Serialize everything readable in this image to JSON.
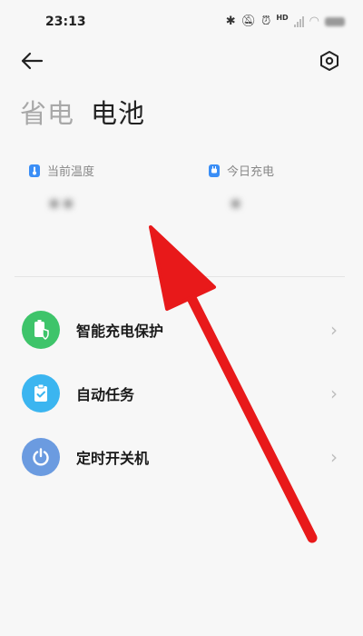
{
  "status_bar": {
    "time": "23:13",
    "hd_label": "HD",
    "icons": [
      "bluetooth-icon",
      "mute-icon",
      "alarm-icon",
      "signal-icon",
      "wifi-icon",
      "battery-icon"
    ]
  },
  "toolbar": {
    "back_icon": "arrow-left-icon",
    "settings_icon": "hex-gear-icon"
  },
  "tabs": [
    {
      "label": "省电",
      "active": false
    },
    {
      "label": "电池",
      "active": true
    }
  ],
  "stats": [
    {
      "label": "当前温度",
      "value": "••",
      "icon": "thermometer-icon",
      "icon_color": "#3a8ef6"
    },
    {
      "label": "今日充电",
      "value": "•",
      "icon": "plug-icon",
      "icon_color": "#3a8ef6"
    }
  ],
  "menu": [
    {
      "label": "智能充电保护",
      "icon": "battery-shield-icon",
      "color": "#3ec46a"
    },
    {
      "label": "自动任务",
      "icon": "clipboard-check-icon",
      "color": "#3bb5f0"
    },
    {
      "label": "定时开关机",
      "icon": "power-icon",
      "color": "#6b9be0"
    }
  ],
  "annotation": {
    "color": "#e8191a"
  }
}
